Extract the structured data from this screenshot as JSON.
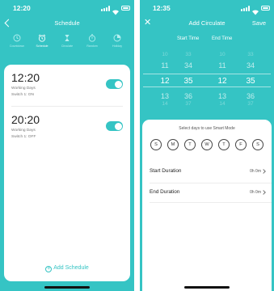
{
  "schedule_screen": {
    "status_time": "12:20",
    "title": "Schedule",
    "tabs": [
      {
        "label": "Countdown",
        "icon": "clock-icon",
        "active": false
      },
      {
        "label": "Schedule",
        "icon": "alarm-clock-icon",
        "active": true
      },
      {
        "label": "Circulate",
        "icon": "hourglass-icon",
        "active": false
      },
      {
        "label": "Random",
        "icon": "stopwatch-icon",
        "active": false
      },
      {
        "label": "Holiday",
        "icon": "pie-clock-icon",
        "active": false
      }
    ],
    "schedules": [
      {
        "time": "12:20",
        "days": "Working Days",
        "action": "Switch 1: ON",
        "enabled": true
      },
      {
        "time": "20:20",
        "days": "Working Days",
        "action": "Switch 1: OFF",
        "enabled": true
      }
    ],
    "add_label": "Add Schedule"
  },
  "circulate_screen": {
    "status_time": "12:35",
    "title": "Add Circulate",
    "save_label": "Save",
    "start_header": "Start Time",
    "end_header": "End Time",
    "start_picker": [
      "10",
      "11",
      "12",
      "13",
      "14"
    ],
    "start_minutes": [
      "33",
      "34",
      "35",
      "36",
      "37"
    ],
    "end_picker": [
      "10",
      "11",
      "12",
      "13",
      "14"
    ],
    "end_minutes": [
      "33",
      "34",
      "35",
      "36",
      "37"
    ],
    "days_label": "Select days to use Smart Mode",
    "days": [
      "S",
      "M",
      "T",
      "W",
      "T",
      "F",
      "S"
    ],
    "start_duration_label": "Start Duration",
    "start_duration_value": "0h 0m",
    "end_duration_label": "End Duration",
    "end_duration_value": "0h 0m"
  },
  "colors": {
    "accent": "#35c4c4",
    "text_dark": "#222222",
    "text_muted": "#777777"
  }
}
